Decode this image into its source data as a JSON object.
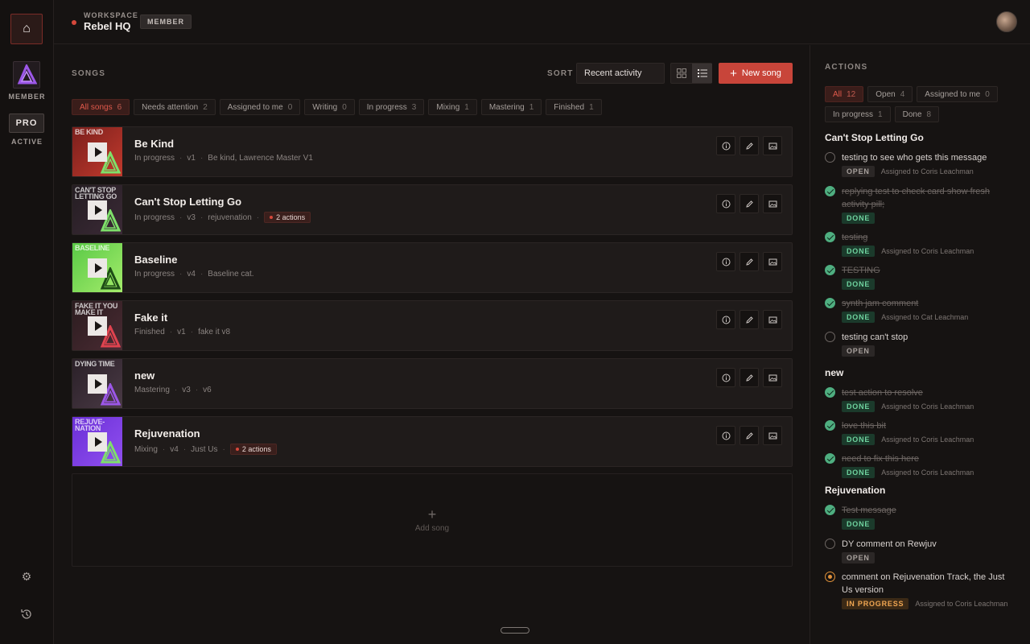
{
  "rail": {
    "member_label": "MEMBER",
    "pro_label": "PRO",
    "active_label": "ACTIVE"
  },
  "header": {
    "workspace_label": "WORKSPACE",
    "workspace_name": "Rebel HQ",
    "role_badge": "MEMBER"
  },
  "songs": {
    "title": "SONGS",
    "sort_label": "SORT",
    "sort_value": "Recent activity",
    "new_song_label": "New song",
    "filters": [
      {
        "label": "All songs",
        "count": "6"
      },
      {
        "label": "Needs attention",
        "count": "2"
      },
      {
        "label": "Assigned to me",
        "count": "0"
      },
      {
        "label": "Writing",
        "count": "0"
      },
      {
        "label": "In progress",
        "count": "3"
      },
      {
        "label": "Mixing",
        "count": "1"
      },
      {
        "label": "Mastering",
        "count": "1"
      },
      {
        "label": "Finished",
        "count": "1"
      }
    ],
    "items": [
      {
        "title": "Be Kind",
        "status": "In progress",
        "version": "v1",
        "detail": "Be kind, Lawrence Master V1",
        "actions": "",
        "art_text": "BE KIND",
        "art_colors": [
          "#7a1f1c",
          "#c23a2d"
        ],
        "tri_color": "#7ee06a"
      },
      {
        "title": "Can't Stop Letting Go",
        "status": "In progress",
        "version": "v3",
        "detail": "rejuvenation",
        "actions": "2 actions",
        "art_text": "CAN'T STOP LETTING GO",
        "art_colors": [
          "#241d22",
          "#3b2a36"
        ],
        "tri_color": "#7ee06a"
      },
      {
        "title": "Baseline",
        "status": "In progress",
        "version": "v4",
        "detail": "Baseline cat.",
        "actions": "",
        "art_text": "BASELINE",
        "art_colors": [
          "#59c946",
          "#a4ec6b"
        ],
        "tri_color": "#1e4d16"
      },
      {
        "title": "Fake it",
        "status": "Finished",
        "version": "v1",
        "detail": "fake it v8",
        "actions": "",
        "art_text": "FAKE IT YOU MAKE IT",
        "art_colors": [
          "#2b1c1f",
          "#4a2b33"
        ],
        "tri_color": "#e0434f"
      },
      {
        "title": "new",
        "status": "Mastering",
        "version": "v3",
        "detail": "v6",
        "actions": "",
        "art_text": "DYING TIME",
        "art_colors": [
          "#2a2028",
          "#4a3a45"
        ],
        "tri_color": "#9c57e8"
      },
      {
        "title": "Rejuvenation",
        "status": "Mixing",
        "version": "v4",
        "detail": "Just Us",
        "actions": "2 actions",
        "art_text": "REJUVE-NATION",
        "art_colors": [
          "#6a2fd6",
          "#9150f0"
        ],
        "tri_color": "#7ee06a"
      }
    ],
    "add_song_label": "Add song"
  },
  "actions": {
    "title": "ACTIONS",
    "filters": [
      {
        "label": "All",
        "count": "12"
      },
      {
        "label": "Open",
        "count": "4"
      },
      {
        "label": "Assigned to me",
        "count": "0"
      },
      {
        "label": "In progress",
        "count": "1"
      },
      {
        "label": "Done",
        "count": "8"
      }
    ],
    "groups": [
      {
        "title": "Can't Stop Letting Go",
        "items": [
          {
            "text": "testing to see who gets this message",
            "state": "open",
            "status": "OPEN",
            "assigned": "Assigned to Coris Leachman"
          },
          {
            "text": "replying test to check card show fresh activity pill;",
            "state": "done",
            "status": "DONE",
            "assigned": ""
          },
          {
            "text": "testing",
            "state": "done",
            "status": "DONE",
            "assigned": "Assigned to Coris Leachman"
          },
          {
            "text": "TESTING",
            "state": "done",
            "status": "DONE",
            "assigned": ""
          },
          {
            "text": "synth jam comment",
            "state": "done",
            "status": "DONE",
            "assigned": "Assigned to Cat Leachman"
          },
          {
            "text": "testing can't stop",
            "state": "open",
            "status": "OPEN",
            "assigned": ""
          }
        ]
      },
      {
        "title": "new",
        "items": [
          {
            "text": "test action to resolve",
            "state": "done",
            "status": "DONE",
            "assigned": "Assigned to Coris Leachman"
          },
          {
            "text": "love this bit",
            "state": "done",
            "status": "DONE",
            "assigned": "Assigned to Coris Leachman"
          },
          {
            "text": "need to fix this here",
            "state": "done",
            "status": "DONE",
            "assigned": "Assigned to Coris Leachman"
          }
        ]
      },
      {
        "title": "Rejuvenation",
        "items": [
          {
            "text": "Test message",
            "state": "done",
            "status": "DONE",
            "assigned": ""
          },
          {
            "text": "DY comment on Rewjuv",
            "state": "open",
            "status": "OPEN",
            "assigned": ""
          },
          {
            "text": "comment on Rejuvenation Track, the Just Us version",
            "state": "inprogress",
            "status": "IN PROGRESS",
            "assigned": "Assigned to Coris Leachman"
          }
        ]
      }
    ]
  },
  "icons": {
    "home": "home-icon",
    "settings": "gear-icon",
    "history": "history-icon",
    "grid_view": "grid-icon",
    "list_view": "list-icon",
    "info": "info-icon",
    "edit": "pencil-icon",
    "image": "image-icon"
  },
  "colors": {
    "accent": "#c8453a",
    "done": "#4fae80",
    "in_progress": "#e0913a"
  }
}
